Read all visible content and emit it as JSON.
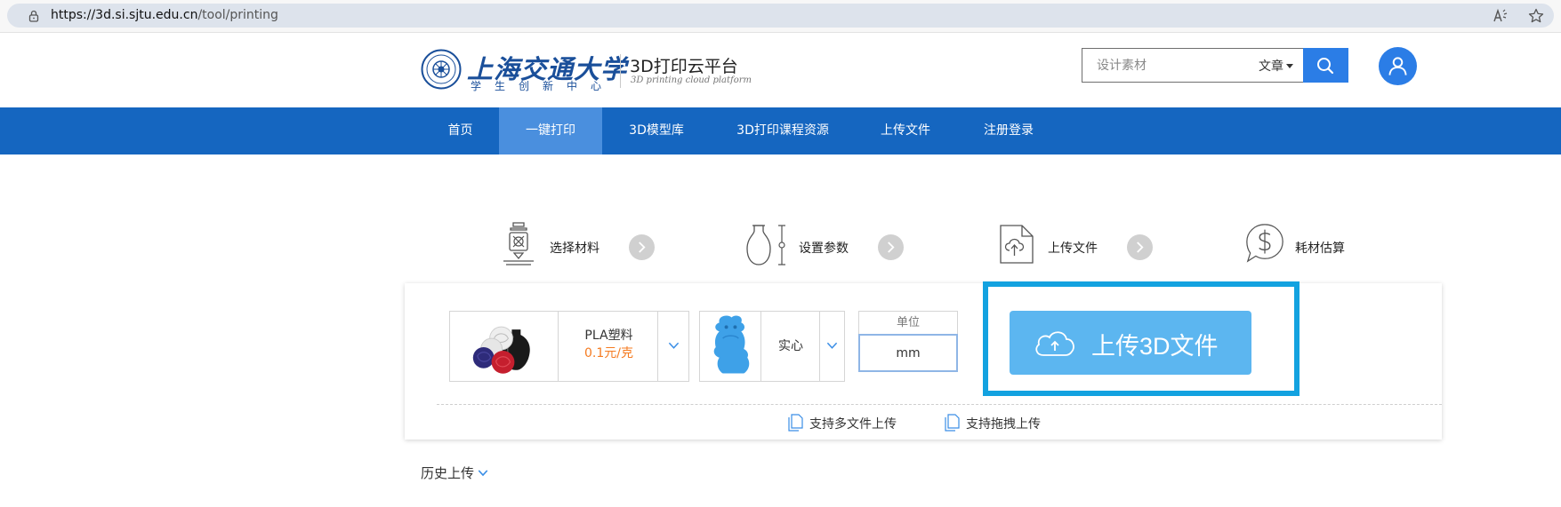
{
  "browser": {
    "url_host": "https://3d.si.sjtu.edu.cn",
    "url_path": "/tool/printing",
    "icons": [
      "lock-icon",
      "read-aloud-icon",
      "favorite-star-icon"
    ]
  },
  "header": {
    "logo_cn": "上海交通大学",
    "logo_sub": "学生创新中心",
    "platform_title": "3D打印云平台",
    "platform_sub": "3D printing cloud platform",
    "search": {
      "placeholder": "设计素材",
      "type_label": "文章",
      "button_icon": "search-icon"
    },
    "user_icon": "user-icon"
  },
  "nav": {
    "items": [
      {
        "label": "首页"
      },
      {
        "label": "一键打印",
        "active": true
      },
      {
        "label": "3D模型库"
      },
      {
        "label": "3D打印课程资源"
      },
      {
        "label": "上传文件"
      },
      {
        "label": "注册登录"
      }
    ]
  },
  "steps": [
    {
      "label": "选择材料",
      "icon": "printer-nozzle-icon"
    },
    {
      "label": "设置参数",
      "icon": "vase-dimension-icon"
    },
    {
      "label": "上传文件",
      "icon": "upload-document-icon"
    },
    {
      "label": "耗材估算",
      "icon": "dollar-chat-icon"
    }
  ],
  "upload_card": {
    "material": {
      "name": "PLA塑料",
      "price": "0.1元/克"
    },
    "fill": {
      "label": "实心"
    },
    "unit": {
      "label": "单位",
      "value": "mm"
    },
    "upload_button_label": "上传3D文件",
    "features": [
      "支持多文件上传",
      "支持拖拽上传"
    ]
  },
  "history": {
    "label": "历史上传"
  },
  "colors": {
    "nav_bg": "#1566c0",
    "nav_active": "#4a8fde",
    "accent_blue": "#2b7de6",
    "upload_button": "#5cb6f0",
    "highlight_frame": "#13a2e0",
    "price_orange": "#f57b20"
  }
}
